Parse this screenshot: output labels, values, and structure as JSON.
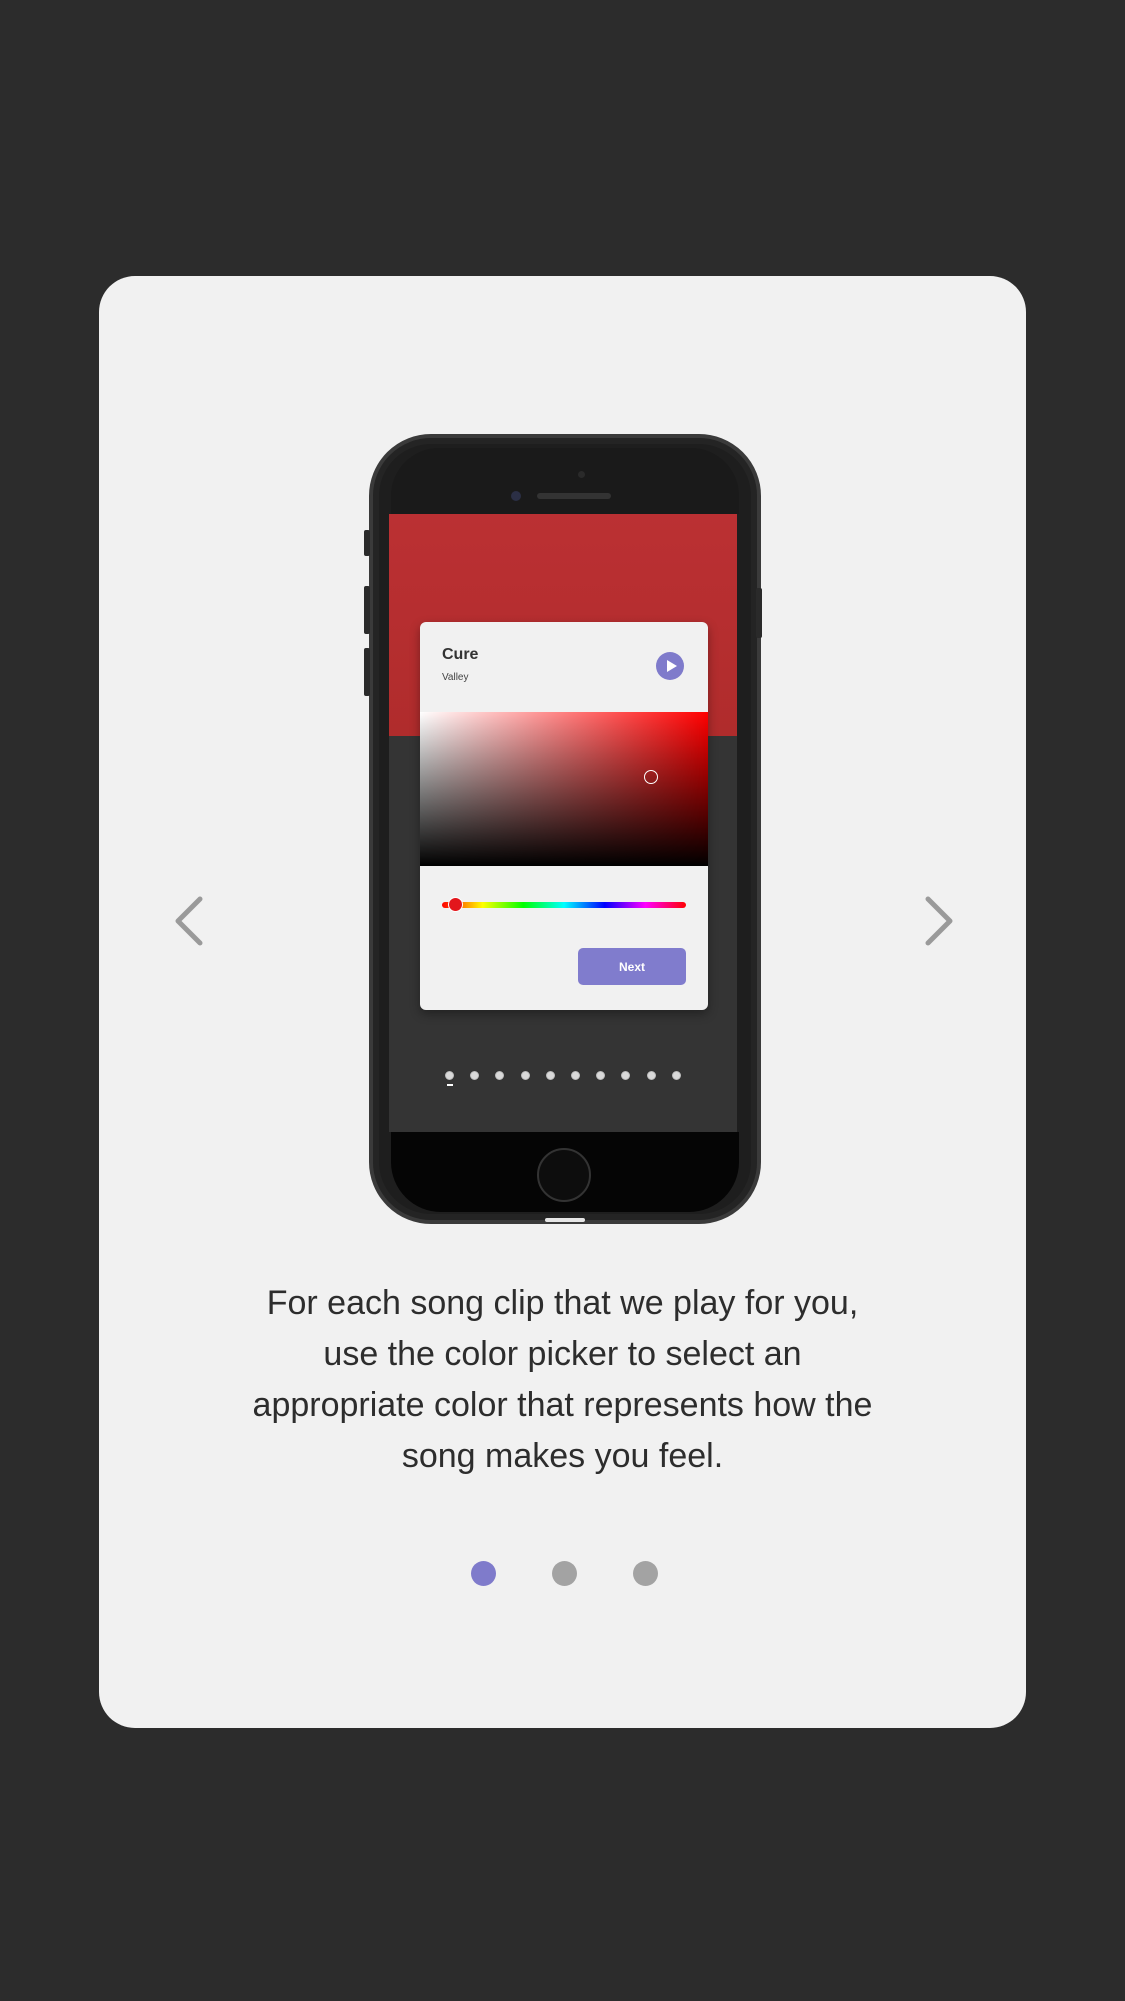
{
  "colors": {
    "background": "#2c2c2c",
    "card": "#f1f1f1",
    "accent": "#7f7bcb",
    "pager_inactive": "#a3a3a3",
    "screen_red": "#bb3033"
  },
  "navigation": {
    "prev_icon": "chevron-left-icon",
    "next_icon": "chevron-right-icon"
  },
  "phone_screen": {
    "song_title": "Cure",
    "song_artist": "Valley",
    "play_icon": "play-icon",
    "next_button_label": "Next",
    "selected_hue_percent": 3,
    "step_dots_total": 10,
    "step_dots_active_index": 0
  },
  "description": "For each song clip that we play for you, use the color picker to select an appropriate color that represents how the song makes you feel.",
  "pager": {
    "total": 3,
    "active_index": 0
  }
}
